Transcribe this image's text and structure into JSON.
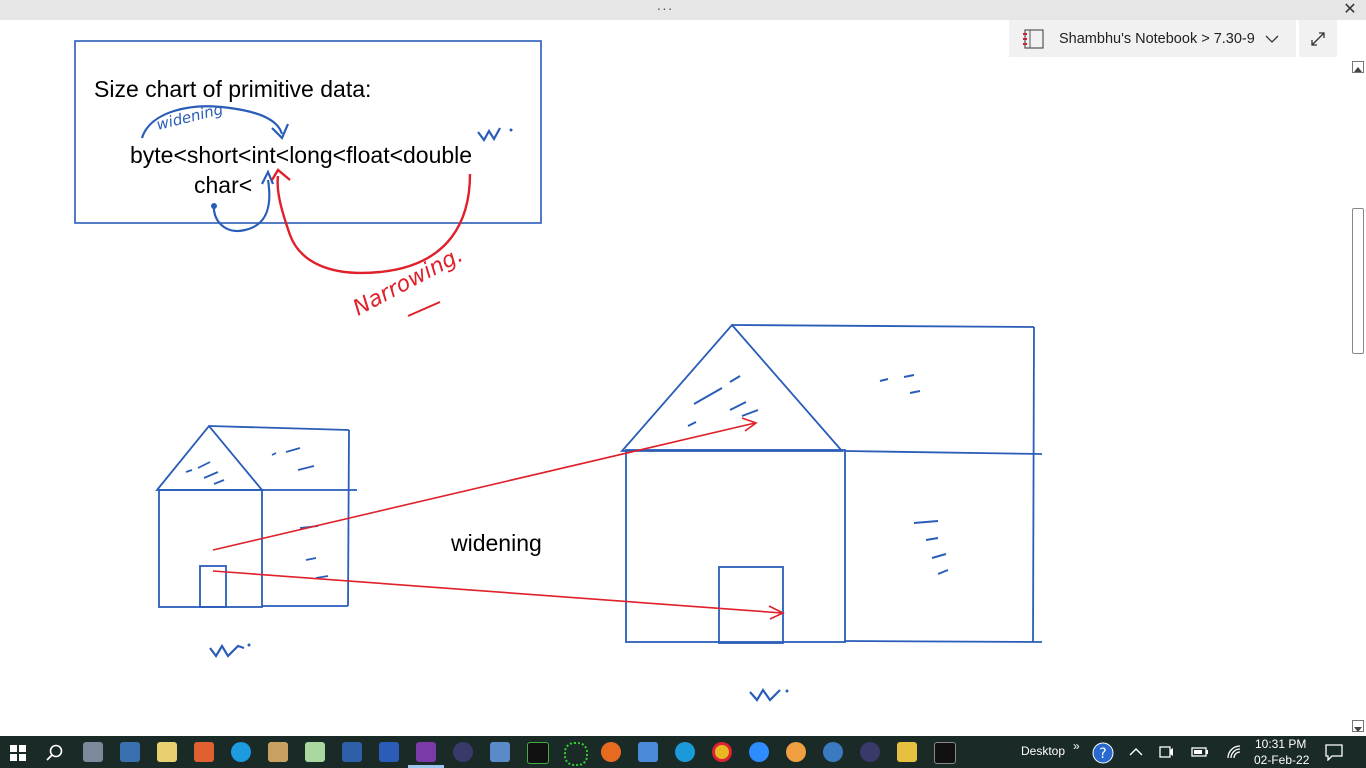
{
  "window": {
    "menu_dots": "···",
    "close_glyph": "✕"
  },
  "breadcrumb": {
    "text": "Shambhu's Notebook > 7.30-9"
  },
  "page": {
    "box_title": "Size chart of primitive data:",
    "chain_line": "byte<short<int<long<float<double",
    "char_line": "char<",
    "widening_label": "widening"
  },
  "ink": {
    "widening_handwritten": "widening",
    "narrowing_handwritten": "Narrowing.",
    "blue": "#2a5db8",
    "red": "#e0202a"
  },
  "taskbar": {
    "background": "#1a2a27",
    "desktop_label": "Desktop",
    "overflow_glyph": "»",
    "time": "10:31 PM",
    "date": "02-Feb-22",
    "apps": [
      {
        "icon": "start-icon"
      },
      {
        "icon": "search-icon"
      },
      {
        "icon": "calculator-icon"
      },
      {
        "icon": "keyboard-icon"
      },
      {
        "icon": "notepad-icon"
      },
      {
        "icon": "paint-icon"
      },
      {
        "icon": "skype-icon"
      },
      {
        "icon": "wordpad-icon"
      },
      {
        "icon": "notepad-plus-icon"
      },
      {
        "icon": "store-icon"
      },
      {
        "icon": "word-icon"
      },
      {
        "icon": "onenote-icon"
      },
      {
        "icon": "eclipse-icon"
      },
      {
        "icon": "photos-icon"
      },
      {
        "icon": "pycharm-icon"
      },
      {
        "icon": "sync-icon"
      },
      {
        "icon": "firefox-icon"
      },
      {
        "icon": "remote-desktop-icon"
      },
      {
        "icon": "edge-icon"
      },
      {
        "icon": "chrome-icon"
      },
      {
        "icon": "zoom-icon"
      },
      {
        "icon": "settings-icon"
      },
      {
        "icon": "snowflake-icon"
      },
      {
        "icon": "eclipse2-icon"
      },
      {
        "icon": "file-explorer-icon"
      },
      {
        "icon": "cmd-icon"
      }
    ]
  }
}
